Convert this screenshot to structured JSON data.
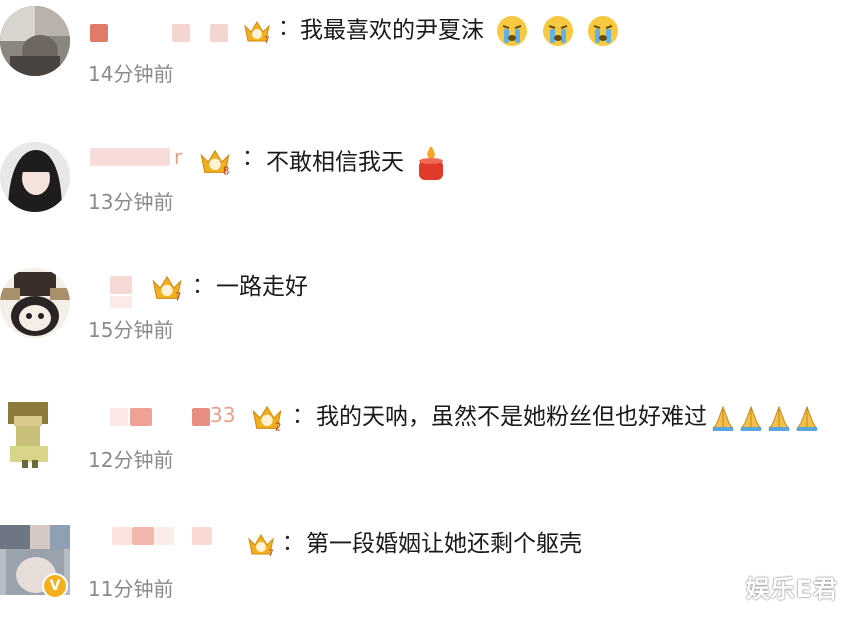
{
  "comments": [
    {
      "separator": "：",
      "text": "我最喜欢的尹夏沫",
      "emojis": [
        "crying-emoji",
        "crying-emoji",
        "crying-emoji"
      ],
      "time": "14分钟前",
      "badge_level": "7"
    },
    {
      "name_suffix": "r",
      "separator": "：",
      "text": "不敢相信我天",
      "emojis": [
        "candle-emoji"
      ],
      "time": "13分钟前",
      "badge_level": "8"
    },
    {
      "separator": "：",
      "text": "一路走好",
      "emojis": [],
      "time": "15分钟前",
      "badge_level": "7"
    },
    {
      "name_suffix": "33",
      "separator": "：",
      "text": "我的天呐，虽然不是她粉丝但也好难过",
      "emojis": [
        "pray-emoji",
        "pray-emoji",
        "pray-emoji",
        "pray-emoji"
      ],
      "time": "12分钟前",
      "badge_level": "2"
    },
    {
      "separator": "：",
      "text": "第一段婚姻让她还剩个躯壳",
      "emojis": [],
      "time": "11分钟前",
      "badge_level": "7",
      "verified": "V"
    }
  ],
  "watermark": "娱乐E君",
  "colors": {
    "badge_gold": "#f2b01e",
    "blur_pink": "#f3c6c0",
    "blur_red": "#e97c6a",
    "time_gray": "#8a8a8a"
  }
}
